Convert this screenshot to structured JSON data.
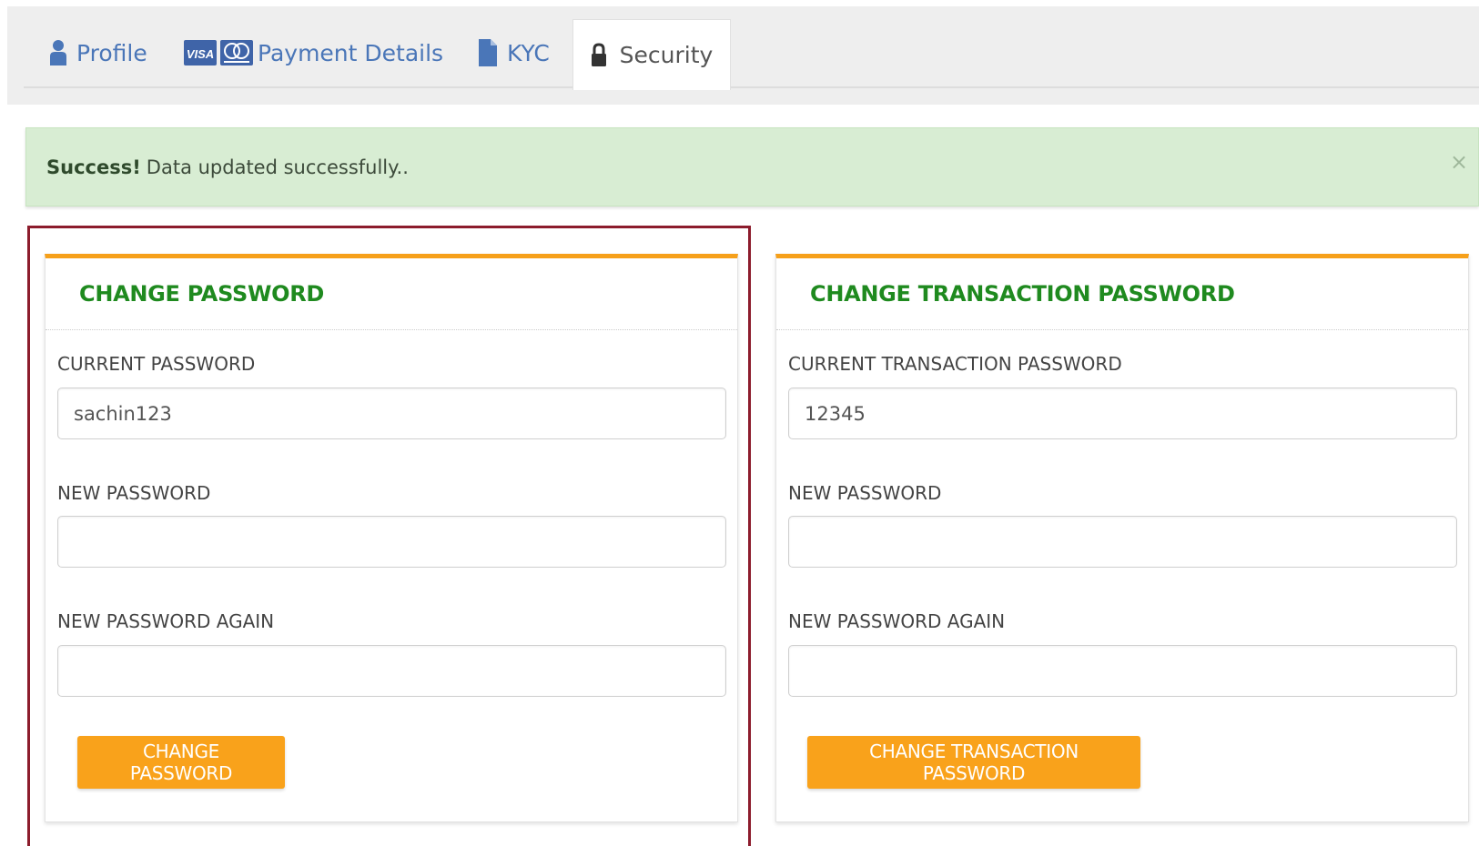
{
  "tabs": {
    "profile": {
      "label": "Profile",
      "icon": "user-icon"
    },
    "payment": {
      "label": "Payment Details",
      "icon": "visa-mastercard-icon",
      "visa_text": "VISA"
    },
    "kyc": {
      "label": "KYC",
      "icon": "document-icon"
    },
    "security": {
      "label": "Security",
      "icon": "lock-icon",
      "active": true
    }
  },
  "alert": {
    "strong": "Success!",
    "message": "Data updated successfully..",
    "close": "×"
  },
  "change_password": {
    "title": "CHANGE PASSWORD",
    "current_label": "CURRENT PASSWORD",
    "current_value": "sachin123",
    "new_label": "NEW PASSWORD",
    "new_value": "",
    "again_label": "NEW PASSWORD AGAIN",
    "again_value": "",
    "button": "CHANGE PASSWORD"
  },
  "change_transaction_password": {
    "title": "CHANGE TRANSACTION PASSWORD",
    "current_label": "CURRENT TRANSACTION PASSWORD",
    "current_value": "12345",
    "new_label": "NEW PASSWORD",
    "new_value": "",
    "again_label": "NEW PASSWORD AGAIN",
    "again_value": "",
    "button": "CHANGE TRANSACTION PASSWORD"
  },
  "colors": {
    "accent": "#f6a01a",
    "title_green": "#1f8a1f",
    "link_blue": "#4a76b8",
    "alert_bg": "#d8edd3",
    "highlight_border": "#8c1c2c"
  }
}
